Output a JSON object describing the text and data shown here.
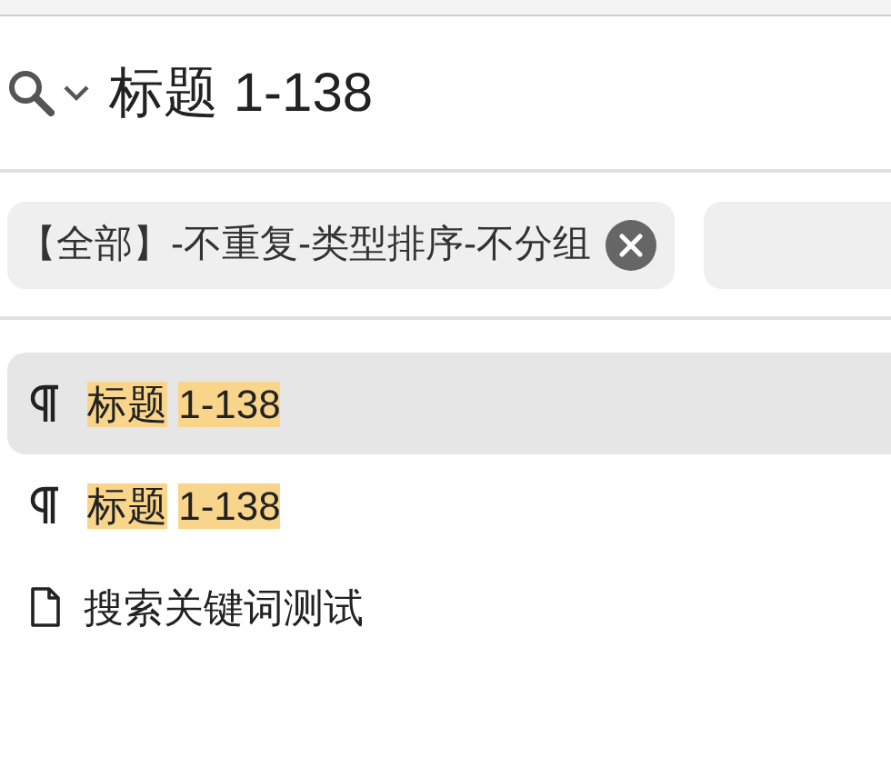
{
  "search": {
    "value": "标题 1-138"
  },
  "filter_chip": {
    "label": "【全部】-不重复-类型排序-不分组"
  },
  "results": [
    {
      "kind": "heading",
      "selected": true,
      "parts": [
        {
          "text": "标题",
          "highlighted": true
        },
        {
          "text": "1-138",
          "highlighted": true
        }
      ]
    },
    {
      "kind": "heading",
      "selected": false,
      "parts": [
        {
          "text": "标题",
          "highlighted": true
        },
        {
          "text": "1-138",
          "highlighted": true
        }
      ]
    },
    {
      "kind": "document",
      "selected": false,
      "parts": [
        {
          "text": "搜索关键词测试",
          "highlighted": false
        }
      ]
    }
  ]
}
